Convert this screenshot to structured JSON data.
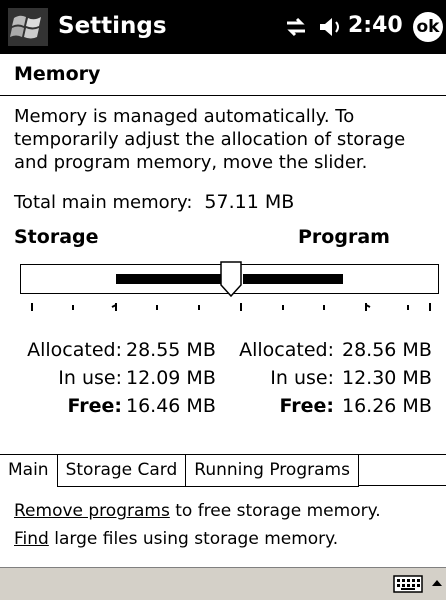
{
  "titlebar": {
    "title": "Settings",
    "clock": "2:40",
    "ok_label": "ok"
  },
  "header": {
    "title": "Memory"
  },
  "description": "Memory is managed automatically. To temporarily adjust the allocation of storage and program memory, move the slider.",
  "total": {
    "label": "Total main memory:",
    "value": "57.11 MB"
  },
  "slider": {
    "left_label": "Storage",
    "right_label": "Program",
    "position_fraction": 0.5
  },
  "storage": {
    "allocated_label": "Allocated:",
    "allocated": "28.55 MB",
    "inuse_label": "In use:",
    "inuse": "12.09 MB",
    "free_label": "Free:",
    "free": "16.46 MB"
  },
  "program": {
    "allocated_label": "Allocated:",
    "allocated": "28.56 MB",
    "inuse_label": "In use:",
    "inuse": "12.30 MB",
    "free_label": "Free:",
    "free": "16.26 MB"
  },
  "tabs": [
    "Main",
    "Storage Card",
    "Running Programs"
  ],
  "links": {
    "line1_link": "Remove programs",
    "line1_rest": " to free storage memory.",
    "line2_link": "Find",
    "line2_rest": " large files using storage memory."
  },
  "icons": {
    "start": "windows-flag-icon",
    "connectivity": "connectivity-icon",
    "volume": "speaker-icon",
    "keyboard": "keyboard-icon",
    "input_menu": "up-arrow-icon"
  }
}
